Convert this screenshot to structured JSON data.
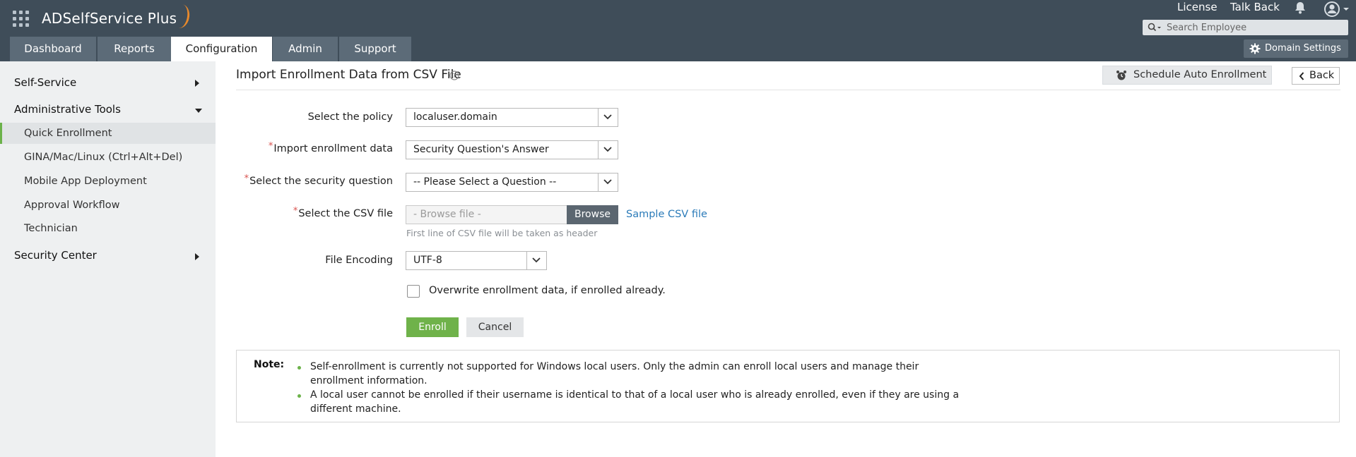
{
  "app": {
    "name": "ADSelfService Plus",
    "accent": "#e8892b",
    "topbar_bg": "#3f4d59"
  },
  "header": {
    "links": [
      "License",
      "Talk Back"
    ],
    "search_placeholder": "Search Employee",
    "domain_settings_label": "Domain Settings"
  },
  "tabs": [
    {
      "label": "Dashboard",
      "active": false
    },
    {
      "label": "Reports",
      "active": false
    },
    {
      "label": "Configuration",
      "active": true
    },
    {
      "label": "Admin",
      "active": false
    },
    {
      "label": "Support",
      "active": false
    }
  ],
  "sidebar": {
    "sections": [
      {
        "label": "Self-Service",
        "expanded": false
      },
      {
        "label": "Administrative Tools",
        "expanded": true
      },
      {
        "label": "Security Center",
        "expanded": false
      }
    ],
    "items": [
      {
        "label": "Quick Enrollment",
        "active": true
      },
      {
        "label": "GINA/Mac/Linux (Ctrl+Alt+Del)",
        "active": false
      },
      {
        "label": "Mobile App Deployment",
        "active": false
      },
      {
        "label": "Approval Workflow",
        "active": false
      },
      {
        "label": "Technician",
        "active": false
      }
    ]
  },
  "page": {
    "title": "Import Enrollment Data from CSV File",
    "schedule_button": "Schedule Auto Enrollment",
    "back_button": "Back"
  },
  "form": {
    "policy": {
      "label": "Select the policy",
      "required": false,
      "value": "localuser.domain"
    },
    "import_data": {
      "label": "Import enrollment data",
      "required": true,
      "value": "Security Question's Answer"
    },
    "security_question": {
      "label": "Select the security question",
      "required": true,
      "value": "-- Please Select a Question --"
    },
    "csv_file": {
      "label": "Select the CSV file",
      "required": true,
      "placeholder": "- Browse file -",
      "browse_label": "Browse",
      "sample_link": "Sample CSV file",
      "hint": "First line of CSV file will be taken as header"
    },
    "encoding": {
      "label": "File Encoding",
      "required": false,
      "value": "UTF-8"
    },
    "overwrite": {
      "label": "Overwrite enrollment data, if enrolled already.",
      "checked": false
    },
    "enroll_label": "Enroll",
    "cancel_label": "Cancel",
    "required_marker": "*"
  },
  "note": {
    "title": "Note:",
    "items": [
      "Self-enrollment is currently not supported for Windows local users. Only the admin can enroll local users and manage their enrollment information.",
      "A local user cannot be enrolled if their username is identical to that of a local user who is already enrolled, even if they are using a different machine."
    ]
  },
  "colors": {
    "primary_button": "#6fb24a",
    "link": "#2b7bb9",
    "required": "#d9534f",
    "sidebar_bg": "#eef0f1"
  }
}
